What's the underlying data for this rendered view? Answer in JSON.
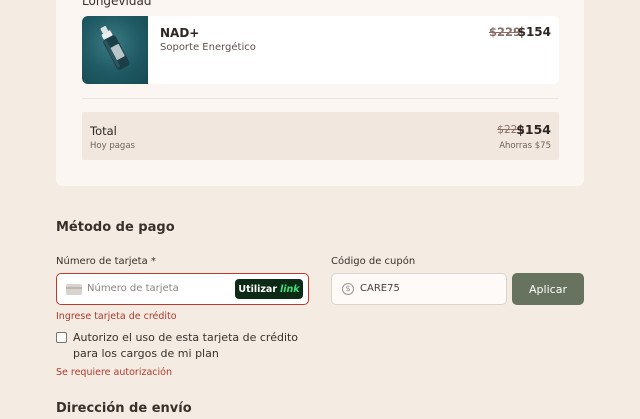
{
  "summary": {
    "section_label": "Longevidad",
    "product": {
      "name": "NAD+",
      "subtitle": "Soporte Energético",
      "price_old": "$229",
      "price_new": "$154",
      "image": "nad-bottle-product-photo"
    },
    "total": {
      "label": "Total",
      "sub_label": "Hoy pagas",
      "price_old": "$229",
      "price_new": "$154",
      "savings": "Ahorras $75"
    }
  },
  "payment": {
    "heading": "Método de pago",
    "card_label": "Número de tarjeta *",
    "card_placeholder": "Número de tarjeta",
    "card_icon": "credit-card-icon",
    "link_button_prefix": "Utilizar",
    "link_button_brand": "link",
    "card_error": "Ingrese tarjeta de crédito",
    "coupon_label": "Código de cupón",
    "coupon_value": "CARE75",
    "coupon_icon": "dollar-coin-icon",
    "apply_label": "Aplicar",
    "authorize_text": "Autorizo el uso de esta tarjeta de crédito para los cargos de mi plan",
    "authorize_checked": false,
    "authorize_error": "Se requiere autorización"
  },
  "shipping": {
    "heading": "Dirección de envío"
  },
  "colors": {
    "background": "#f4ebe3",
    "card_bg": "#fbf6f1",
    "error": "#b03a2e",
    "apply_button": "#68735f",
    "link_button_bg": "#0c2a16",
    "link_brand": "#3de07a"
  }
}
